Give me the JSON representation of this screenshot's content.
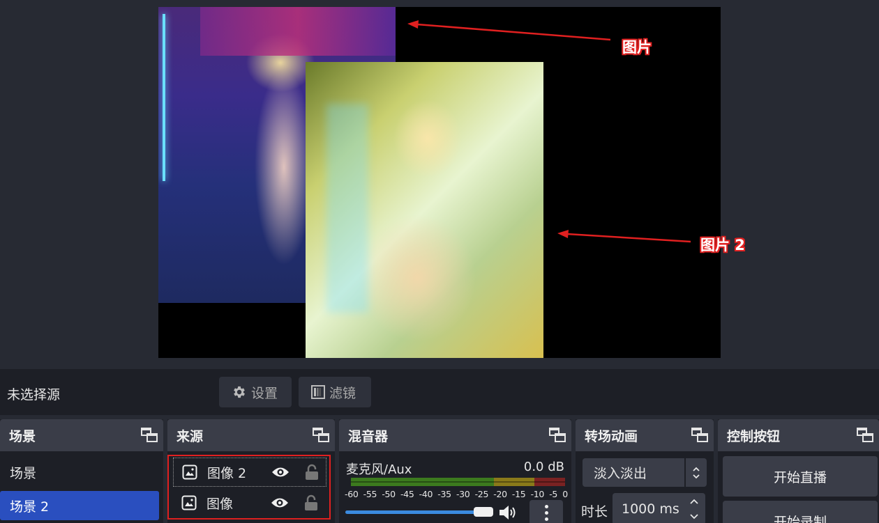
{
  "preview": {
    "annotations": [
      "图片",
      "图片 2"
    ]
  },
  "source_toolbar": {
    "no_source_text": "未选择源",
    "settings_label": "设置",
    "filters_label": "滤镜"
  },
  "docks": {
    "scenes": {
      "title": "场景",
      "items": [
        {
          "label": "场景",
          "active": false
        },
        {
          "label": "场景 2",
          "active": true
        }
      ]
    },
    "sources": {
      "title": "来源",
      "items": [
        {
          "label": "图像 2"
        },
        {
          "label": "图像"
        }
      ]
    },
    "mixer": {
      "title": "混音器",
      "channel_name": "麦克风/Aux",
      "channel_db": "0.0 dB",
      "ticks": [
        "-60",
        "-55",
        "-50",
        "-45",
        "-40",
        "-35",
        "-30",
        "-25",
        "-20",
        "-15",
        "-10",
        "-5",
        "0"
      ],
      "volume_level": 1.0
    },
    "transitions": {
      "title": "转场动画",
      "selected": "淡入淡出",
      "duration_label": "时长",
      "duration_value": "1000 ms"
    },
    "controls": {
      "title": "控制按钮",
      "start_streaming": "开始直播",
      "start_recording": "开始录制"
    }
  },
  "colors": {
    "accent": "#2a4fbf",
    "annotation": "#e02020",
    "slider": "#3b8be0"
  }
}
